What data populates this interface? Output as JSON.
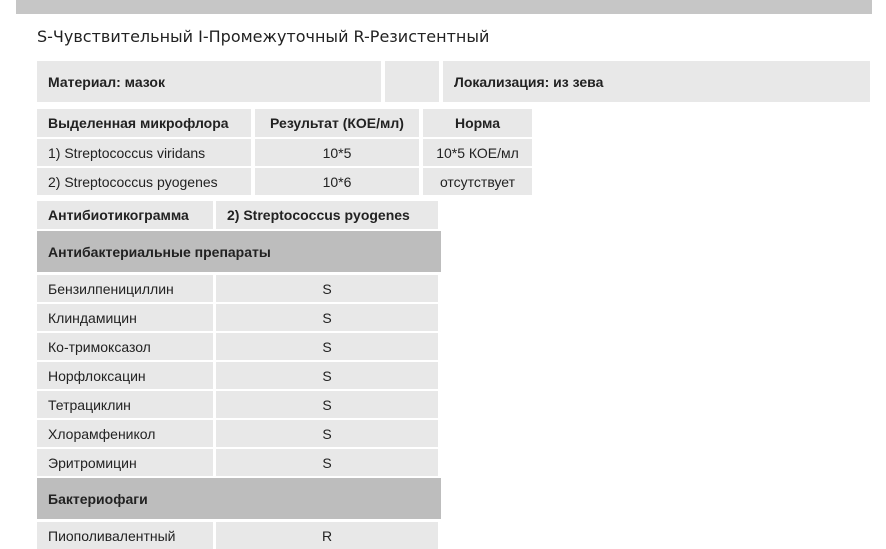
{
  "legend": "S-Чувствительный I-Промежуточный R-Резистентный",
  "info": {
    "material": "Материал: мазок",
    "localization": "Локализация: из зева"
  },
  "microflora": {
    "headers": [
      "Выделенная микрофлора",
      "Результат (КОЕ/мл)",
      "Норма"
    ],
    "rows": [
      [
        "1) Streptococcus viridans",
        "10*5",
        "10*5 КОЕ/мл"
      ],
      [
        "2) Streptococcus pyogenes",
        "10*6",
        "отсутствует"
      ]
    ]
  },
  "antibiogram": {
    "title": "Антибиотикограмма",
    "organism": "2) Streptococcus pyogenes",
    "section_antibacterial": "Антибактериальные препараты",
    "drugs": [
      {
        "name": "Бензилпенициллин",
        "result": "S"
      },
      {
        "name": "Клиндамицин",
        "result": "S"
      },
      {
        "name": "Ко-тримоксазол",
        "result": "S"
      },
      {
        "name": "Норфлоксацин",
        "result": "S"
      },
      {
        "name": "Тетрациклин",
        "result": "S"
      },
      {
        "name": "Хлорамфеникол",
        "result": "S"
      },
      {
        "name": "Эритромицин",
        "result": "S"
      }
    ],
    "section_phages": "Бактериофаги",
    "phages": [
      {
        "name": "Пиополивалентный",
        "result": "R"
      }
    ]
  }
}
